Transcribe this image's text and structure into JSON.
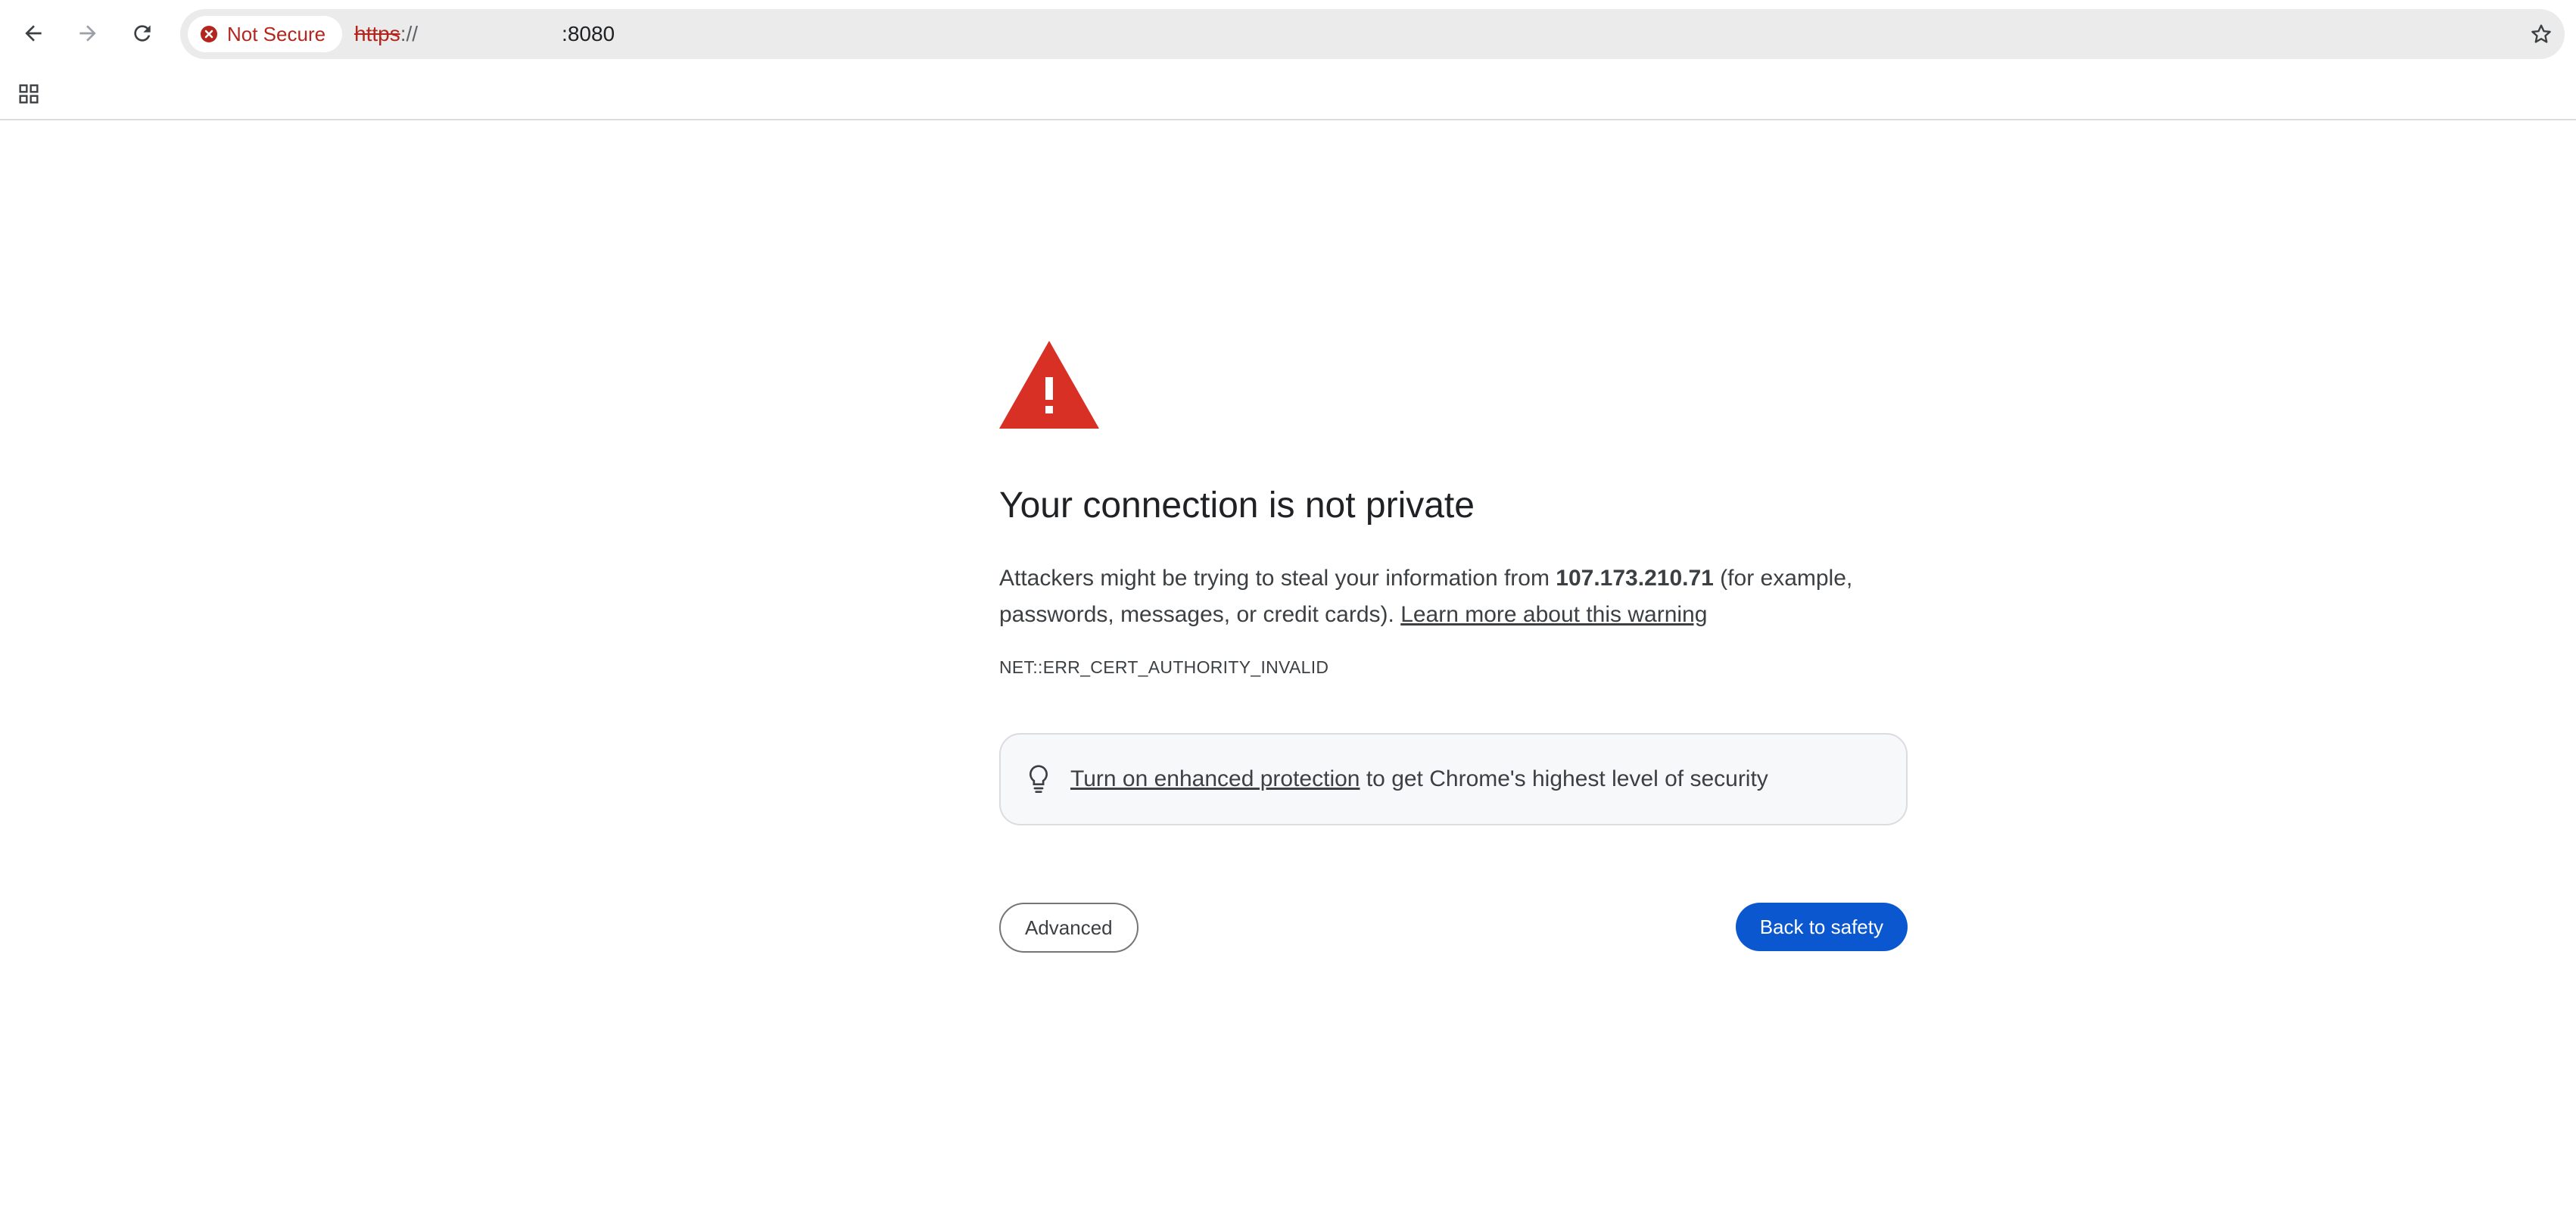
{
  "browser": {
    "security_chip_label": "Not Secure",
    "url": {
      "scheme": "https",
      "separator": "://",
      "host": "",
      "port": ":8080"
    },
    "icons": {
      "back": "arrow-left-icon",
      "forward": "arrow-right-icon",
      "reload": "reload-icon",
      "security": "error-circle-icon",
      "bookmark": "star-icon",
      "apps": "apps-grid-icon"
    }
  },
  "interstitial": {
    "heading": "Your connection is not private",
    "explanation_before": "Attackers might be trying to steal your information from ",
    "host": "107.173.210.71",
    "explanation_after": " (for example, passwords, messages, or credit cards). ",
    "learn_more_link": "Learn more about this warning",
    "error_code": "NET::ERR_CERT_AUTHORITY_INVALID",
    "protection": {
      "link": "Turn on enhanced protection",
      "text": " to get Chrome's highest level of security"
    },
    "advanced_button": "Advanced",
    "back_to_safety_button": "Back to safety"
  },
  "colors": {
    "warning_red": "#d93025",
    "not_secure_red": "#b3261e",
    "primary_blue": "#0b57d0",
    "omnibox_bg": "#ebebec",
    "protection_box_bg": "#f7f8fa"
  }
}
